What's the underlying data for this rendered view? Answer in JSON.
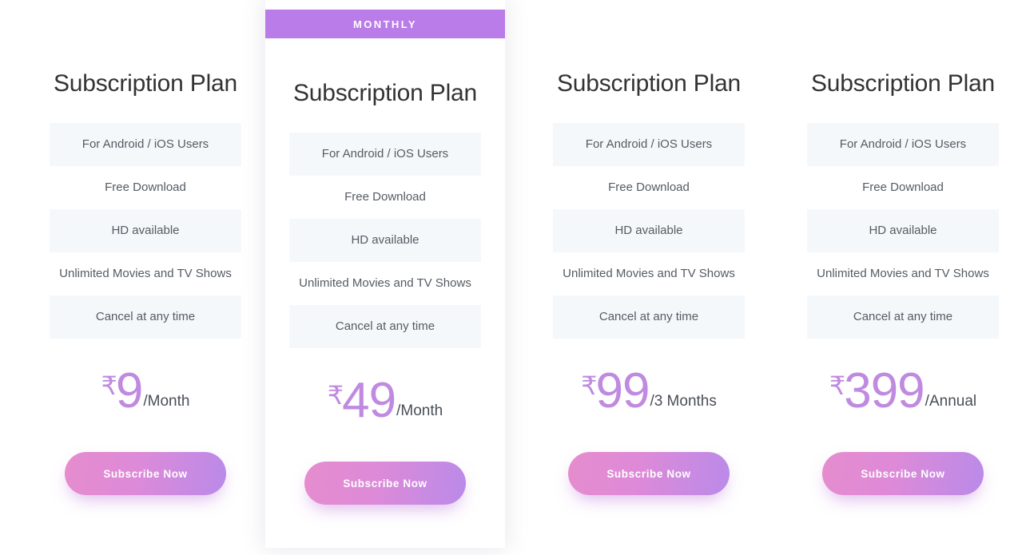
{
  "theme": {
    "accent_purple": "#bf8ae0",
    "badge_purple": "#b97ce8",
    "button_gradient_start": "#e68cce",
    "button_gradient_end": "#b98ae9",
    "feature_row_shade": "#f5f8fb",
    "title_color": "#333333",
    "page_background": "#ffffff"
  },
  "plans": [
    {
      "badge": null,
      "title": "Subscription Plan",
      "features": [
        "For Android / iOS Users",
        "Free Download",
        "HD available",
        "Unlimited Movies and TV Shows",
        "Cancel at any time"
      ],
      "currency": "₹",
      "amount": "9",
      "period": "/Month",
      "cta": "Subscribe Now"
    },
    {
      "badge": "MONTHLY",
      "title": "Subscription Plan",
      "features": [
        "For Android / iOS Users",
        "Free Download",
        "HD available",
        "Unlimited Movies and TV Shows",
        "Cancel at any time"
      ],
      "currency": "₹",
      "amount": "49",
      "period": "/Month",
      "cta": "Subscribe Now"
    },
    {
      "badge": null,
      "title": "Subscription Plan",
      "features": [
        "For Android / iOS Users",
        "Free Download",
        "HD available",
        "Unlimited Movies and TV Shows",
        "Cancel at any time"
      ],
      "currency": "₹",
      "amount": "99",
      "period": "/3 Months",
      "cta": "Subscribe Now"
    },
    {
      "badge": null,
      "title": "Subscription Plan",
      "features": [
        "For Android / iOS Users",
        "Free Download",
        "HD available",
        "Unlimited Movies and TV Shows",
        "Cancel at any time"
      ],
      "currency": "₹",
      "amount": "399",
      "period": "/Annual",
      "cta": "Subscribe Now"
    }
  ]
}
